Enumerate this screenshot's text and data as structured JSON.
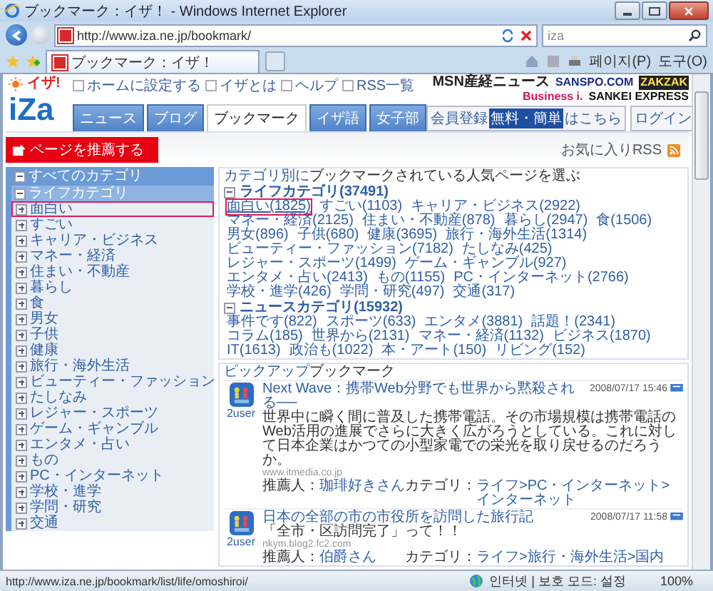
{
  "window": {
    "title": "ブックマーク：イザ！ - Windows Internet Explorer"
  },
  "address_bar": {
    "url": "http://www.iza.ne.jp/bookmark/"
  },
  "search": {
    "value": "iza"
  },
  "browser_tab": {
    "title": "ブックマーク：イザ！"
  },
  "browser_tools": [
    "페이지(P)",
    "도구(O)"
  ],
  "header": {
    "logo": "iZa",
    "logo_tag": "イザ!",
    "top_links": [
      "ホームに設定する",
      "イザとは",
      "ヘルプ",
      "RSS一覧"
    ],
    "partners": [
      "MSN産経ニュース",
      "SANSPO.COM",
      "ZAKZAK",
      "Business i.",
      "SANKEI EXPRESS"
    ],
    "tabs": [
      {
        "label": "ニュース",
        "selected": false
      },
      {
        "label": "ブログ",
        "selected": false
      },
      {
        "label": "ブックマーク",
        "selected": true
      },
      {
        "label": "イザ語",
        "selected": false
      },
      {
        "label": "女子部",
        "selected": false
      }
    ],
    "register": {
      "label": "会員登録",
      "badge": "無料・簡単",
      "suffix": "はこちら"
    },
    "login": "ログイン"
  },
  "recommend_button": "ページを推薦する",
  "rss_link": "お気に入りRSS",
  "sidebar": {
    "tree": [
      {
        "label": "すべてのカテゴリ",
        "expanded": true,
        "children": [
          {
            "label": "ライフカテゴリ",
            "expanded": true,
            "children": [
              {
                "label": "面白い",
                "expanded": false,
                "highlighted": true
              },
              {
                "label": "すごい",
                "expanded": false,
                "highlighted": false
              },
              {
                "label": "キャリア・ビジネス",
                "expanded": false,
                "highlighted": false
              },
              {
                "label": "マネー・経済",
                "expanded": false,
                "highlighted": false
              },
              {
                "label": "住まい・不動産",
                "expanded": false,
                "highlighted": false
              },
              {
                "label": "暮らし",
                "expanded": false,
                "highlighted": false
              },
              {
                "label": "食",
                "expanded": false,
                "highlighted": false
              },
              {
                "label": "男女",
                "expanded": false,
                "highlighted": false
              },
              {
                "label": "子供",
                "expanded": false,
                "highlighted": false
              },
              {
                "label": "健康",
                "expanded": false,
                "highlighted": false
              },
              {
                "label": "旅行・海外生活",
                "expanded": false,
                "highlighted": false
              },
              {
                "label": "ビューティー・ファッション",
                "expanded": false,
                "highlighted": false
              },
              {
                "label": "たしなみ",
                "expanded": false,
                "highlighted": false
              },
              {
                "label": "レジャー・スポーツ",
                "expanded": false,
                "highlighted": false
              },
              {
                "label": "ゲーム・ギャンブル",
                "expanded": false,
                "highlighted": false
              },
              {
                "label": "エンタメ・占い",
                "expanded": false,
                "highlighted": false
              },
              {
                "label": "もの",
                "expanded": false,
                "highlighted": false
              },
              {
                "label": "PC・インターネット",
                "expanded": false,
                "highlighted": false
              },
              {
                "label": "学校・進学",
                "expanded": false,
                "highlighted": false
              },
              {
                "label": "学問・研究",
                "expanded": false,
                "highlighted": false
              },
              {
                "label": "交通",
                "expanded": false,
                "highlighted": false
              }
            ]
          }
        ]
      }
    ]
  },
  "intro": {
    "link": "カテゴリ別に",
    "text": "ブックマークされている人気ページを選ぶ"
  },
  "sections": [
    {
      "title": "ライフカテゴリ(37491)",
      "expanded": true,
      "links": [
        {
          "label": "面白い(1825)",
          "highlighted": true
        },
        {
          "label": "すごい(1103)",
          "highlighted": false
        },
        {
          "label": "キャリア・ビジネス(2922)",
          "highlighted": false
        },
        {
          "label": "マネー・経済(2125)",
          "highlighted": false
        },
        {
          "label": "住まい・不動産(878)",
          "highlighted": false
        },
        {
          "label": "暮らし(2947)",
          "highlighted": false
        },
        {
          "label": "食(1506)",
          "highlighted": false
        },
        {
          "label": "男女(896)",
          "highlighted": false
        },
        {
          "label": "子供(680)",
          "highlighted": false
        },
        {
          "label": "健康(3695)",
          "highlighted": false
        },
        {
          "label": "旅行・海外生活(1314)",
          "highlighted": false
        },
        {
          "label": "ビューティー・ファッション(7182)",
          "highlighted": false
        },
        {
          "label": "たしなみ(425)",
          "highlighted": false
        },
        {
          "label": "レジャー・スポーツ(1499)",
          "highlighted": false
        },
        {
          "label": "ゲーム・ギャンブル(927)",
          "highlighted": false
        },
        {
          "label": "エンタメ・占い(2413)",
          "highlighted": false
        },
        {
          "label": "もの(1155)",
          "highlighted": false
        },
        {
          "label": "PC・インターネット(2766)",
          "highlighted": false
        },
        {
          "label": "学校・進学(426)",
          "highlighted": false
        },
        {
          "label": "学問・研究(497)",
          "highlighted": false
        },
        {
          "label": "交通(317)",
          "highlighted": false
        }
      ]
    },
    {
      "title": "ニュースカテゴリ(15932)",
      "expanded": true,
      "links": [
        {
          "label": "事件です(822)",
          "highlighted": false
        },
        {
          "label": "スポーツ(633)",
          "highlighted": false
        },
        {
          "label": "エンタメ(3881)",
          "highlighted": false
        },
        {
          "label": "話題！(2341)",
          "highlighted": false
        },
        {
          "label": "コラム(185)",
          "highlighted": false
        },
        {
          "label": "世界から(2131)",
          "highlighted": false
        },
        {
          "label": "マネー・経済(1132)",
          "highlighted": false
        },
        {
          "label": "ビジネス(1870)",
          "highlighted": false
        },
        {
          "label": "IT(1613)",
          "highlighted": false
        },
        {
          "label": "政治も(1022)",
          "highlighted": false
        },
        {
          "label": "本・アート(150)",
          "highlighted": false
        },
        {
          "label": "リビング(152)",
          "highlighted": false
        }
      ]
    }
  ],
  "pickup": {
    "link": "ピックアップ",
    "text": "ブックマーク",
    "items": [
      {
        "title": "Next Wave：携帯Web分野でも世界から黙殺される──",
        "date": "2008/07/17 15:46",
        "users": "2user",
        "body": "世界中に瞬く間に普及した携帯電話。その市場規模は携帯電話のWeb活用の進展でさらに大きく広がろうとしている。これに対して日本企業はかつての小型家電での栄光を取り戻せるのだろうか。",
        "source": "www.itmedia.co.jp",
        "recommender_label": "推薦人：",
        "recommender": "珈琲好きさん",
        "category_label": "カテゴリ：",
        "category": "ライフ>PC・インターネット>インターネット"
      },
      {
        "title": "日本の全部の市の市役所を訪問した旅行記",
        "date": "2008/07/17 11:58",
        "users": "2user",
        "body": "「全市・区訪問完了」って！！",
        "source": "nkym.blog2.fc2.com",
        "recommender_label": "推薦人：",
        "recommender": "伯爵さん",
        "category_label": "カテゴリ：",
        "category": "ライフ>旅行・海外生活>国内"
      }
    ]
  },
  "status_bar": {
    "url": "http://www.iza.ne.jp/bookmark/list/life/omoshiroi/",
    "zone": "인터넷 | 보호 모드: 설정",
    "zoom": "100%"
  }
}
